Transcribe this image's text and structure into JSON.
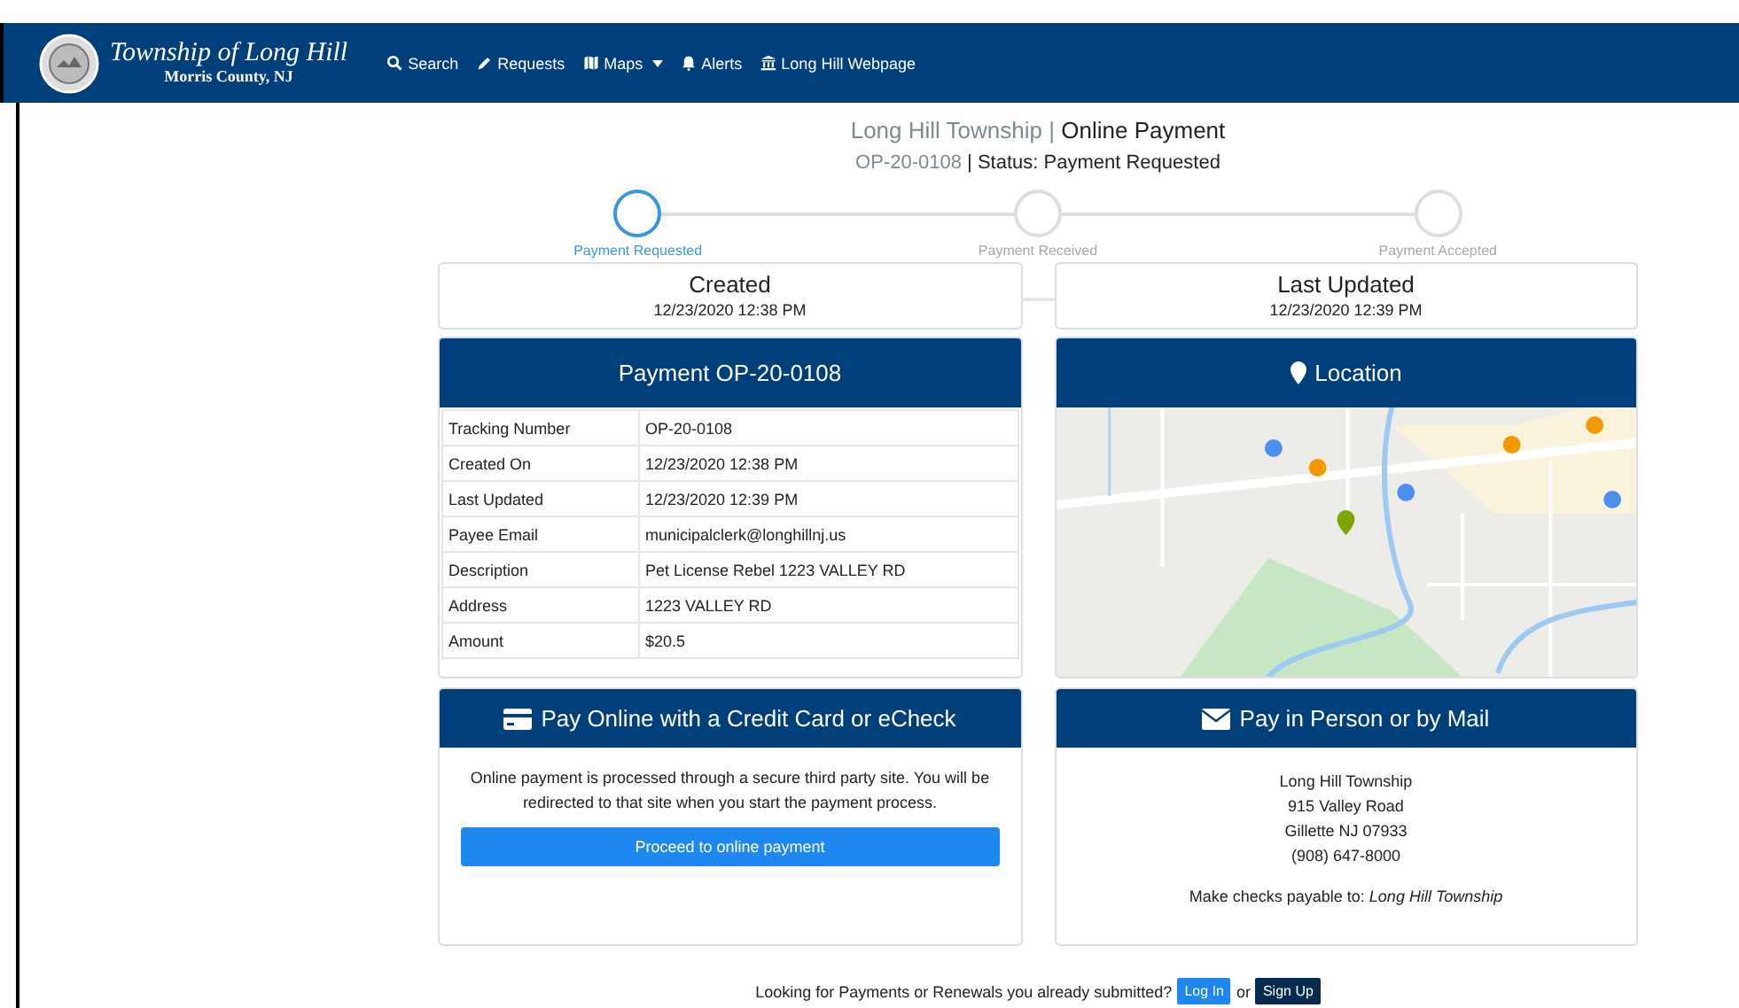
{
  "navbar": {
    "brand_title": "Township of Long Hill",
    "brand_subtitle": "Morris County, NJ",
    "items": [
      {
        "label": "Search",
        "dropdown": false
      },
      {
        "label": "Requests",
        "dropdown": false
      },
      {
        "label": "Maps",
        "dropdown": true
      },
      {
        "label": "Alerts",
        "dropdown": false
      },
      {
        "label": "Long Hill Webpage",
        "dropdown": false
      }
    ]
  },
  "page_header": {
    "org": "Long Hill Township",
    "separator": "|",
    "title": "Online Payment",
    "id": "OP-20-0108",
    "status": "Status: Payment Requested"
  },
  "steps": [
    {
      "label": "Payment Requested",
      "selected": true
    },
    {
      "label": "Payment Received",
      "selected": false
    },
    {
      "label": "Payment Accepted",
      "selected": false
    }
  ],
  "dates": [
    {
      "title": "Created",
      "value": "12/23/2020 12:38 PM"
    },
    {
      "title": "Last Updated",
      "value": "12/23/2020 12:39 PM"
    }
  ],
  "payment_card": {
    "title": "Payment OP-20-0108",
    "rows": [
      {
        "label": "Tracking Number",
        "value": "OP-20-0108"
      },
      {
        "label": "Created On",
        "value": "12/23/2020 12:38 PM"
      },
      {
        "label": "Last Updated",
        "value": "12/23/2020 12:39 PM"
      },
      {
        "label": "Payee Email",
        "value": "municipalclerk@longhillnj.us"
      },
      {
        "label": "Description",
        "value": "Pet License Rebel 1223 VALLEY RD"
      },
      {
        "label": "Address",
        "value": "1223 VALLEY RD"
      },
      {
        "label": "Amount",
        "value": "$20.5"
      }
    ]
  },
  "location_card": {
    "title": "Location"
  },
  "online_card": {
    "title": "Pay Online with a Credit Card or eCheck",
    "text": "Online payment is processed through a secure third party site. You will be redirected to that site when you start the payment process.",
    "button": "Proceed to online payment"
  },
  "mail_card": {
    "title": "Pay in Person or by Mail",
    "lines": [
      "Long Hill Township",
      "915 Valley Road",
      "Gillette NJ 07933",
      "(908) 647-8000"
    ],
    "payable_note": "Make checks payable to: *Long Hill Township*"
  },
  "footer": {
    "text": "Looking for Payments or Renewals you already submitted?",
    "login": "Log In",
    "or": "or",
    "signup": "Sign Up"
  }
}
